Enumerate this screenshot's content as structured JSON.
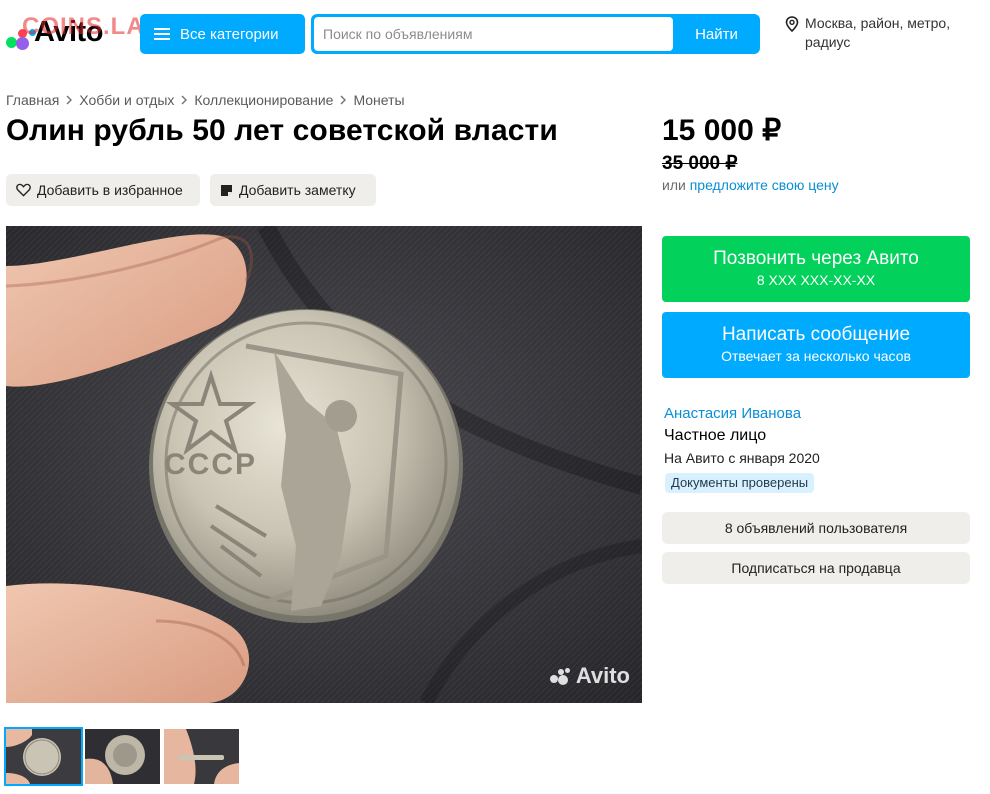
{
  "header": {
    "brand": "Avito",
    "watermark": "COINS.LAVE.RU",
    "categories_label": "Все категории",
    "search_placeholder": "Поиск по объявлениям",
    "search_button": "Найти",
    "location": "Москва, район, метро, радиус"
  },
  "breadcrumb": [
    "Главная",
    "Хобби и отдых",
    "Коллекционирование",
    "Монеты"
  ],
  "listing": {
    "title": "Олин рубль 50 лет советской власти",
    "favorite_label": "Добавить в избранное",
    "note_label": "Добавить заметку",
    "photo_watermark": "Avito"
  },
  "price": {
    "current": "15 000 ₽",
    "old": "35 000 ₽",
    "offer_prefix": "или",
    "offer_link": "предложите свою цену"
  },
  "actions": {
    "call_main": "Позвонить через Авито",
    "call_sub": "8 XXX XXX-XX-XX",
    "message_main": "Написать сообщение",
    "message_sub": "Отвечает за несколько часов"
  },
  "seller": {
    "name": "Анастасия Иванова",
    "type": "Частное лицо",
    "since": "На Авито с января 2020",
    "badge": "Документы проверены",
    "ads_button": "8 объявлений пользователя",
    "subscribe_button": "Подписаться на продавца"
  },
  "colors": {
    "accent_blue": "#00aaff",
    "call_green": "#02d15c",
    "link_blue": "#0a8ed4",
    "gray_button": "#f0eeeb"
  }
}
